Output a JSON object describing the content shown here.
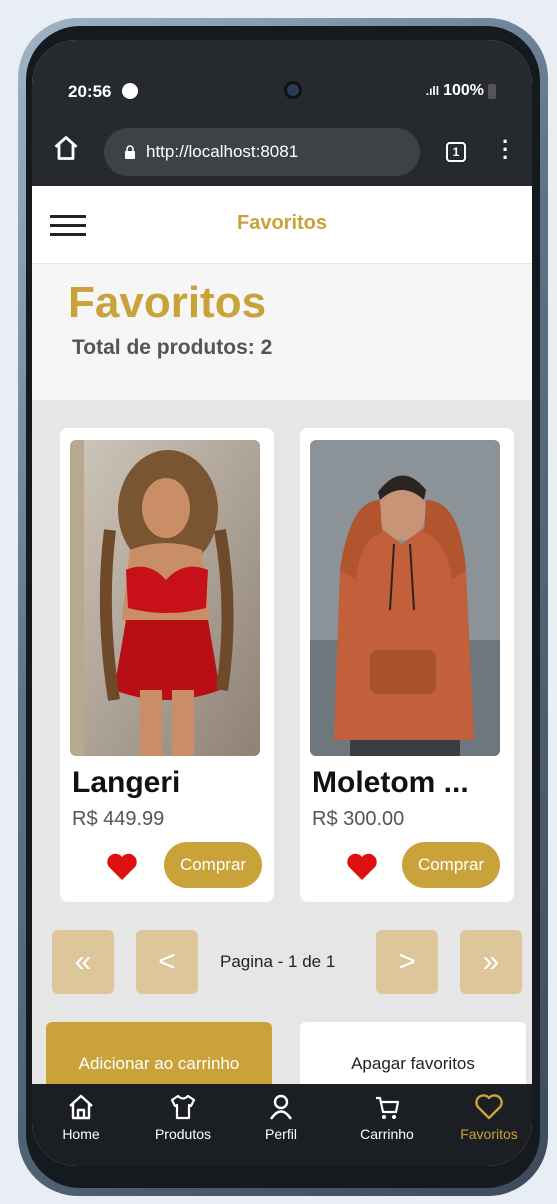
{
  "status_bar": {
    "time": "20:56",
    "battery": "100%"
  },
  "browser": {
    "url": "http://localhost:8081",
    "tab_count": "1"
  },
  "header": {
    "title": "Favoritos"
  },
  "page": {
    "title": "Favoritos",
    "total_label": "Total de produtos: 2"
  },
  "products": [
    {
      "name": "Langeri",
      "price": "R$ 449.99",
      "buy_label": "Comprar",
      "image_icon": "lingerie-photo"
    },
    {
      "name": "Moletom ...",
      "price": "R$ 300.00",
      "buy_label": "Comprar",
      "image_icon": "hoodie-photo"
    }
  ],
  "pagination": {
    "label": "Pagina - 1 de 1",
    "first": "«",
    "prev": "<",
    "next": ">",
    "last": "»"
  },
  "actions": {
    "add_to_cart": "Adicionar ao carrinho",
    "clear_favorites": "Apagar favoritos"
  },
  "bottom_nav": [
    {
      "label": "Home",
      "icon": "home-icon"
    },
    {
      "label": "Produtos",
      "icon": "shirt-icon"
    },
    {
      "label": "Perfil",
      "icon": "person-icon"
    },
    {
      "label": "Carrinho",
      "icon": "cart-icon"
    },
    {
      "label": "Favoritos",
      "icon": "heart-icon",
      "active": true
    }
  ],
  "colors": {
    "accent": "#c9a23a",
    "accent_light": "#dcc69a",
    "heart": "#e01010",
    "dark_bar": "#26292d"
  }
}
